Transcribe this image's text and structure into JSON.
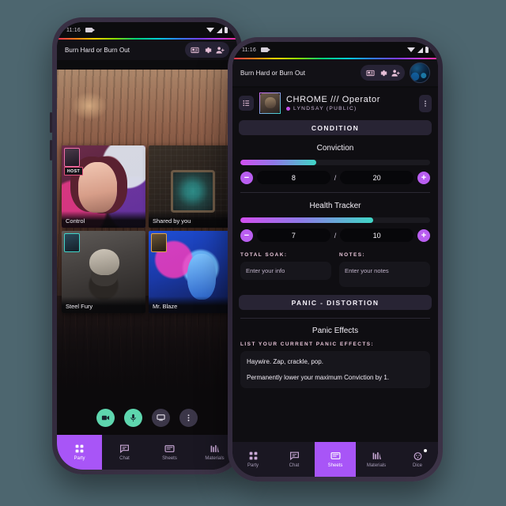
{
  "background_color": "#4d666f",
  "accent": {
    "purple": "#a855f7",
    "magenta": "#d24ff0",
    "teal": "#3fd6c6",
    "green": "#5ed6ae"
  },
  "left_phone": {
    "status_bar": {
      "time": "11:16",
      "camera_icon": "video-camera-icon",
      "wifi_icon": "wifi-icon",
      "signal_icon": "signal-icon",
      "battery_icon": "battery-icon"
    },
    "header": {
      "title": "Burn Hard or Burn Out",
      "icons": [
        "handout-icon",
        "gear-icon",
        "add-person-icon"
      ]
    },
    "tiles": [
      {
        "label": "Control",
        "badge": "host-avatar",
        "badge_color": "pink",
        "host_tag": "HOST",
        "art": "art-control"
      },
      {
        "label": "Shared by you",
        "badge": null,
        "art": "art-map"
      },
      {
        "label": "Steel Fury",
        "badge": "player-avatar",
        "badge_color": "cyan",
        "art": "art-steel"
      },
      {
        "label": "Mr. Blaze",
        "badge": "player-avatar",
        "badge_color": "gold",
        "art": "art-blaze"
      }
    ],
    "call_controls": [
      "camera-icon",
      "microphone-icon",
      "screen-share-icon",
      "more-options-icon"
    ],
    "bottom_nav": [
      {
        "label": "Party",
        "icon": "grid-icon",
        "active": true
      },
      {
        "label": "Chat",
        "icon": "chat-icon",
        "active": false
      },
      {
        "label": "Sheets",
        "icon": "sheet-icon",
        "active": false
      },
      {
        "label": "Materials",
        "icon": "materials-icon",
        "active": false
      }
    ]
  },
  "right_phone": {
    "status_bar": {
      "time": "11:16",
      "camera_icon": "video-camera-icon",
      "wifi_icon": "wifi-icon",
      "signal_icon": "signal-icon",
      "battery_icon": "battery-icon"
    },
    "header": {
      "title": "Burn Hard or Burn Out",
      "icons": [
        "handout-icon",
        "gear-icon",
        "add-person-icon"
      ],
      "avatar": "user-avatar"
    },
    "character": {
      "name": "CHROME /// Operator",
      "owner": "LYNDSAY (PUBLIC)",
      "menu_icon": "list-icon",
      "kebab_icon": "more-vertical-icon"
    },
    "condition_button": "CONDITION",
    "trackers": [
      {
        "title": "Conviction",
        "current": "8",
        "max": "20",
        "separator": "/",
        "fill_percent": 40,
        "minus": "−",
        "plus": "+"
      },
      {
        "title": "Health Tracker",
        "current": "7",
        "max": "10",
        "separator": "/",
        "fill_percent": 70,
        "minus": "−",
        "plus": "+"
      }
    ],
    "fields": [
      {
        "label": "TOTAL SOAK:",
        "value": "",
        "placeholder": "Enter your info"
      },
      {
        "label": "NOTES:",
        "value": "",
        "placeholder": "Enter your notes"
      }
    ],
    "panic_button": "PANIC - DISTORTION",
    "panic_section_title": "Panic Effects",
    "panic_list_label": "LIST YOUR CURRENT PANIC EFFECTS:",
    "panic_effects": [
      "Haywire. Zap, crackle, pop.",
      "Permanently lower your maximum Conviction by 1."
    ],
    "bottom_nav": [
      {
        "label": "Party",
        "icon": "grid-icon",
        "active": false
      },
      {
        "label": "Chat",
        "icon": "chat-icon",
        "active": false
      },
      {
        "label": "Sheets",
        "icon": "sheet-icon",
        "active": true
      },
      {
        "label": "Materials",
        "icon": "materials-icon",
        "active": false
      },
      {
        "label": "Dice",
        "icon": "dice-icon",
        "active": false,
        "badge": true
      }
    ]
  }
}
